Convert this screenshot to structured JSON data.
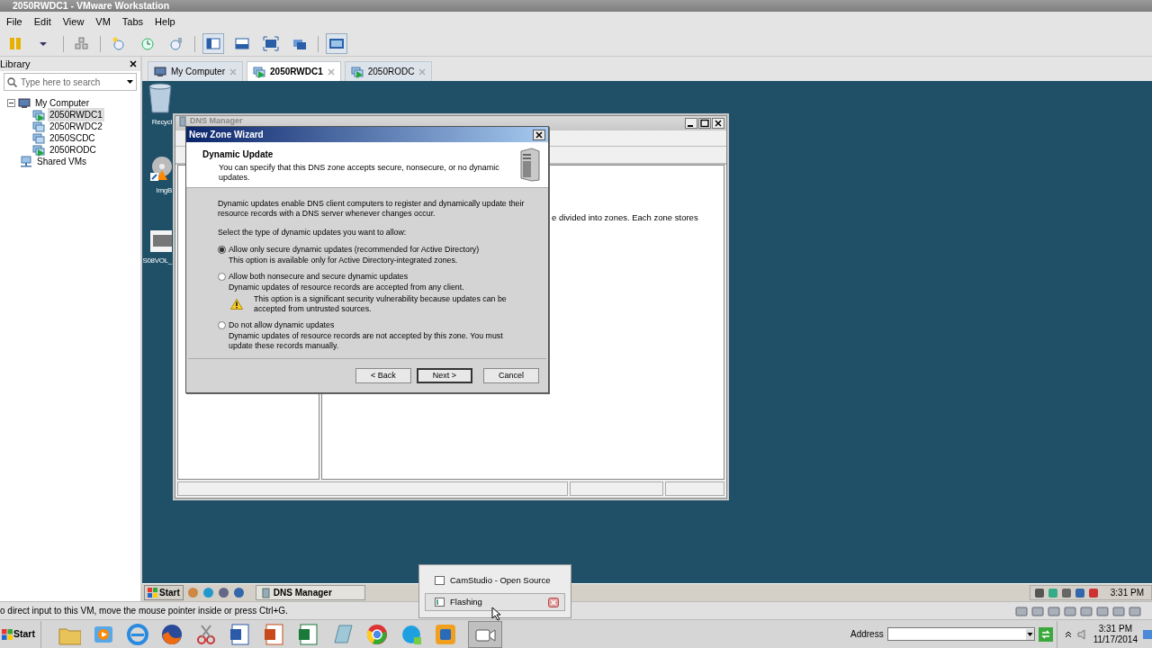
{
  "window": {
    "title": "2050RWDC1 - VMware Workstation"
  },
  "menu": [
    "File",
    "Edit",
    "View",
    "VM",
    "Tabs",
    "Help"
  ],
  "library": {
    "title": "Library",
    "search": {
      "placeholder": "Type here to search"
    },
    "tree": [
      {
        "label": "My Computer",
        "kind": "computer",
        "expanded": true,
        "selected": false,
        "children": [
          {
            "label": "2050RWDC1",
            "kind": "vm",
            "running": true,
            "selected": true
          },
          {
            "label": "2050RWDC2",
            "kind": "vm",
            "running": false,
            "selected": false
          },
          {
            "label": "2050SCDC",
            "kind": "vm",
            "running": false,
            "selected": false
          },
          {
            "label": "2050RODC",
            "kind": "vm",
            "running": true,
            "selected": false
          }
        ]
      },
      {
        "label": "Shared VMs",
        "kind": "shared",
        "selected": false
      }
    ]
  },
  "tabs": [
    {
      "label": "My Computer",
      "kind": "computer",
      "selected": false
    },
    {
      "label": "2050RWDC1",
      "kind": "vm",
      "selected": true
    },
    {
      "label": "2050RODC",
      "kind": "vm",
      "selected": false
    }
  ],
  "guest": {
    "desktop_icons": [
      {
        "label": "Recycl",
        "kind": "recycle-bin"
      },
      {
        "label": "ImgB",
        "kind": "disc"
      },
      {
        "label": "S08VOL_",
        "kind": "vm"
      }
    ],
    "dns_manager": {
      "title": "DNS Manager",
      "body_text": "e divided into zones. Each zone stores"
    },
    "wizard": {
      "title": "New Zone Wizard",
      "heading": "Dynamic Update",
      "subheading": "You can specify that this DNS zone accepts secure, nonsecure, or no dynamic updates.",
      "intro": "Dynamic updates enable DNS client computers to register and dynamically update their resource records with a DNS server whenever changes occur.",
      "prompt": "Select the type of dynamic updates you want to allow:",
      "options": [
        {
          "label": "Allow only secure dynamic updates (recommended for Active Directory)",
          "description": "This option is available only for Active Directory-integrated zones.",
          "selected": true
        },
        {
          "label": "Allow both nonsecure and secure dynamic updates",
          "description": "Dynamic updates of resource records are accepted from any client.",
          "warning": "This option is a significant security vulnerability because updates can be accepted from untrusted sources.",
          "selected": false
        },
        {
          "label": "Do not allow dynamic updates",
          "description": "Dynamic updates of resource records are not accepted by this zone. You must update these records manually.",
          "selected": false
        }
      ],
      "buttons": [
        {
          "label": "< Back",
          "default": false
        },
        {
          "label": "Next >",
          "default": true
        },
        {
          "label": "Cancel",
          "default": false
        }
      ]
    },
    "taskbar": {
      "start": "Start",
      "task": "DNS Manager",
      "clock": "3:31 PM"
    }
  },
  "thumbnail_popup": {
    "items": [
      {
        "label": "CamStudio - Open Source",
        "selected": false
      },
      {
        "label": "Flashing",
        "selected": true
      }
    ]
  },
  "status_message": "o direct input to this VM, move the mouse pointer inside or press Ctrl+G.",
  "host_taskbar": {
    "start": "Start",
    "address_label": "Address",
    "clock_time": "3:31 PM",
    "clock_date": "11/17/2014"
  }
}
